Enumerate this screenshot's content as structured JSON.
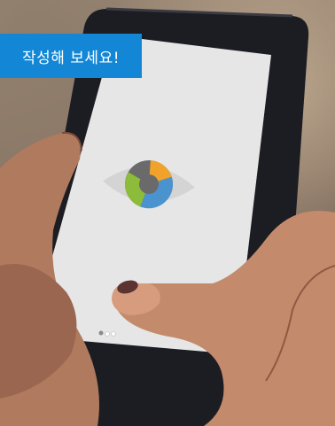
{
  "badge": {
    "label": "작성해 보세요!"
  },
  "screen": {
    "page_indicator": {
      "active": 0,
      "count": 3
    }
  },
  "colors": {
    "badge_bg": "#1387d6",
    "screen_bg": "#e4e4e4",
    "eye_segments": [
      "#f1a22a",
      "#4b93cf",
      "#8dbb3a",
      "#6a6a6a"
    ]
  },
  "icons": [
    "eye-icon"
  ]
}
